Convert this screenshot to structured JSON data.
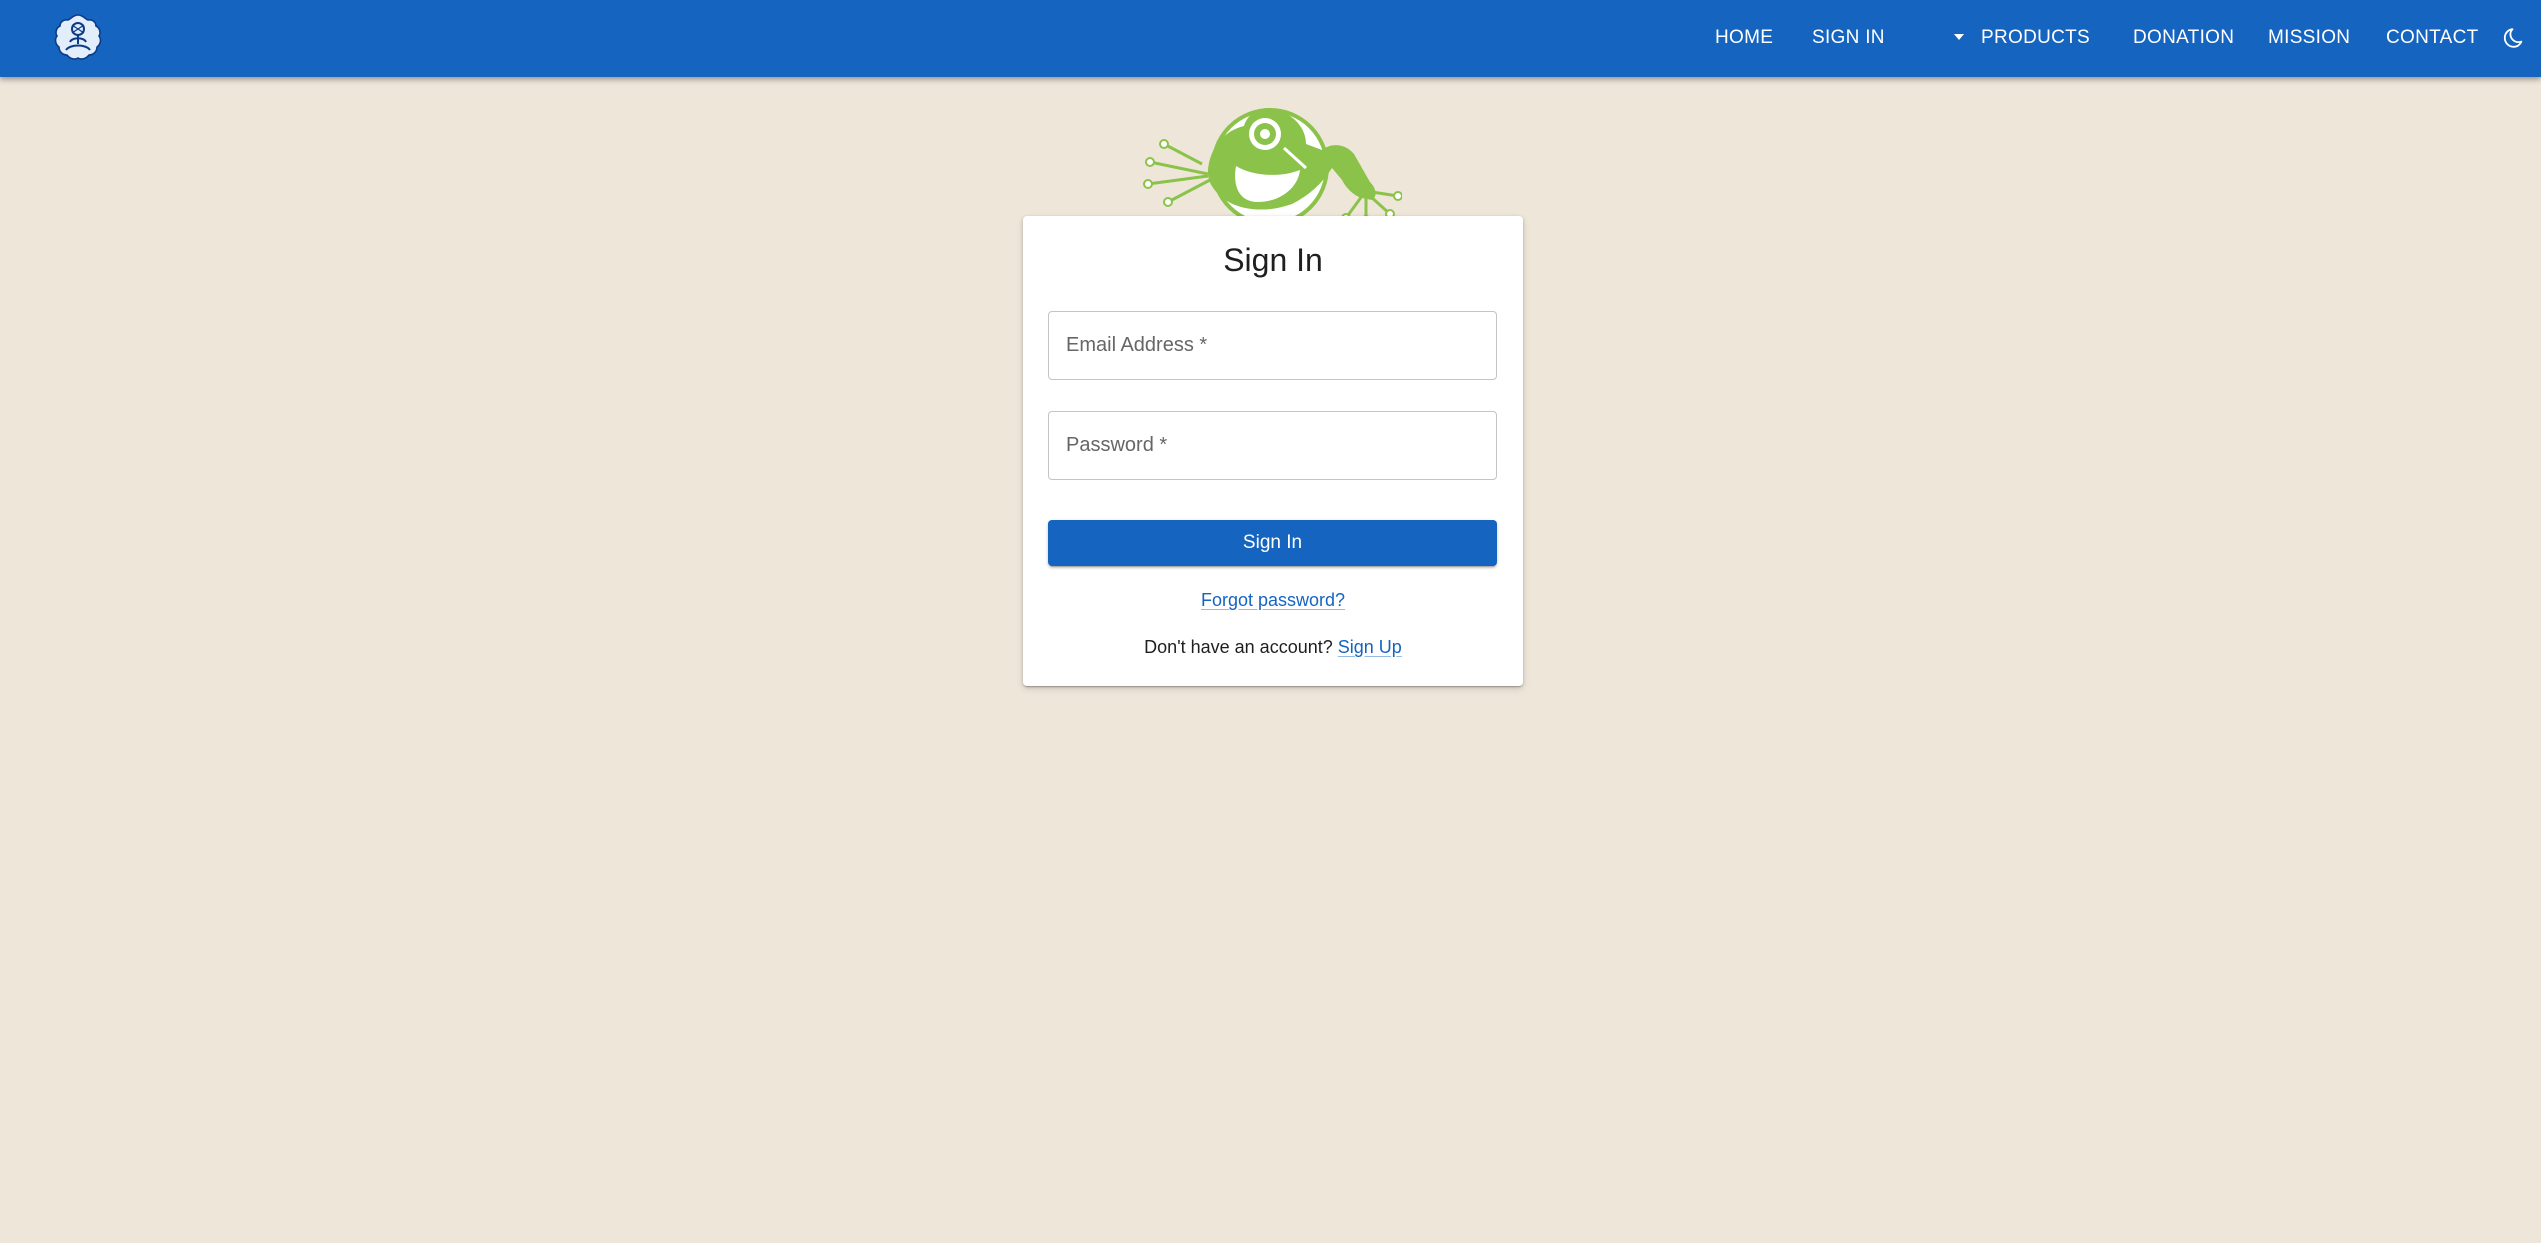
{
  "nav": {
    "home": "HOME",
    "sign_in": "SIGN IN",
    "products": "PRODUCTS",
    "donation": "DONATION",
    "mission": "MISSION",
    "contact": "CONTACT"
  },
  "colors": {
    "appbar": "#1565c0",
    "background": "#efe6da",
    "frog_green": "#8bc34a"
  },
  "icons": {
    "brand": "brand-logo-icon",
    "dropdown": "arrow-drop-down-icon",
    "theme": "dark-mode-moon-icon",
    "mascot": "frog-mascot-icon"
  },
  "signin": {
    "title": "Sign In",
    "email_label": "Email Address *",
    "password_label": "Password *",
    "submit": "Sign In",
    "forgot": "Forgot password?",
    "no_account": "Don't have an account?",
    "signup": "Sign Up"
  }
}
